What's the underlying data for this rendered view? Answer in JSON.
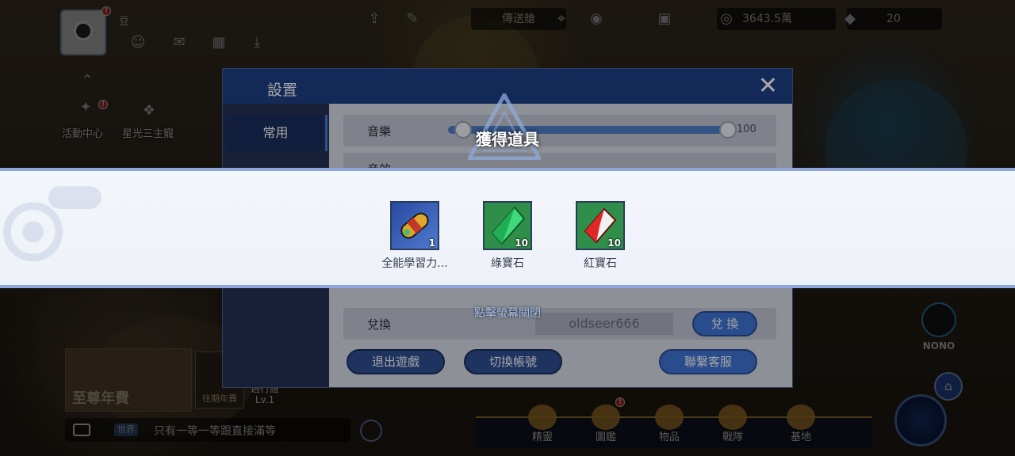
{
  "hud": {
    "player_name": "豆",
    "teleport_label": "傳送艙",
    "currency_value": "3643.5萬",
    "gem_value": "20",
    "badge_mark": "!",
    "activity_center": "活動中心",
    "star_master": "星光三主寵",
    "supreme_annual": "至尊年費",
    "past_annual": "往期年費",
    "weekly_label": "週行證",
    "weekly_level": "Lv.1",
    "nono_label": "NONO"
  },
  "chat": {
    "channel": "世界",
    "message": "只有一等一等跟直接滿等"
  },
  "bottom_nav": {
    "items": [
      {
        "label": "精靈"
      },
      {
        "label": "圖鑑"
      },
      {
        "label": "物品"
      },
      {
        "label": "戰隊"
      },
      {
        "label": "基地"
      }
    ]
  },
  "settings": {
    "title": "設置",
    "close": "✕",
    "tab_common": "常用",
    "rows": {
      "music_label": "音樂",
      "music_value": "100",
      "sound_label": "音效",
      "redeem_label": "兌換",
      "redeem_code": "oldseer666",
      "redeem_button": "兌 換"
    },
    "buttons": {
      "quit": "退出遊戲",
      "switch_account": "切換帳號",
      "contact": "聯繫客服"
    }
  },
  "reward_popup": {
    "title": "獲得道具",
    "items": [
      {
        "name": "全能學習力...",
        "count": "1",
        "icon": "learning-power-capsule-icon"
      },
      {
        "name": "綠寶石",
        "count": "10",
        "icon": "green-gem-icon"
      },
      {
        "name": "紅寶石",
        "count": "10",
        "icon": "red-gem-icon"
      }
    ],
    "hint": "點擊螢幕關閉"
  },
  "colors": {
    "band_border": "#8ea6dc",
    "panel_header": "#1e3f86",
    "button": "#2e4f94"
  }
}
